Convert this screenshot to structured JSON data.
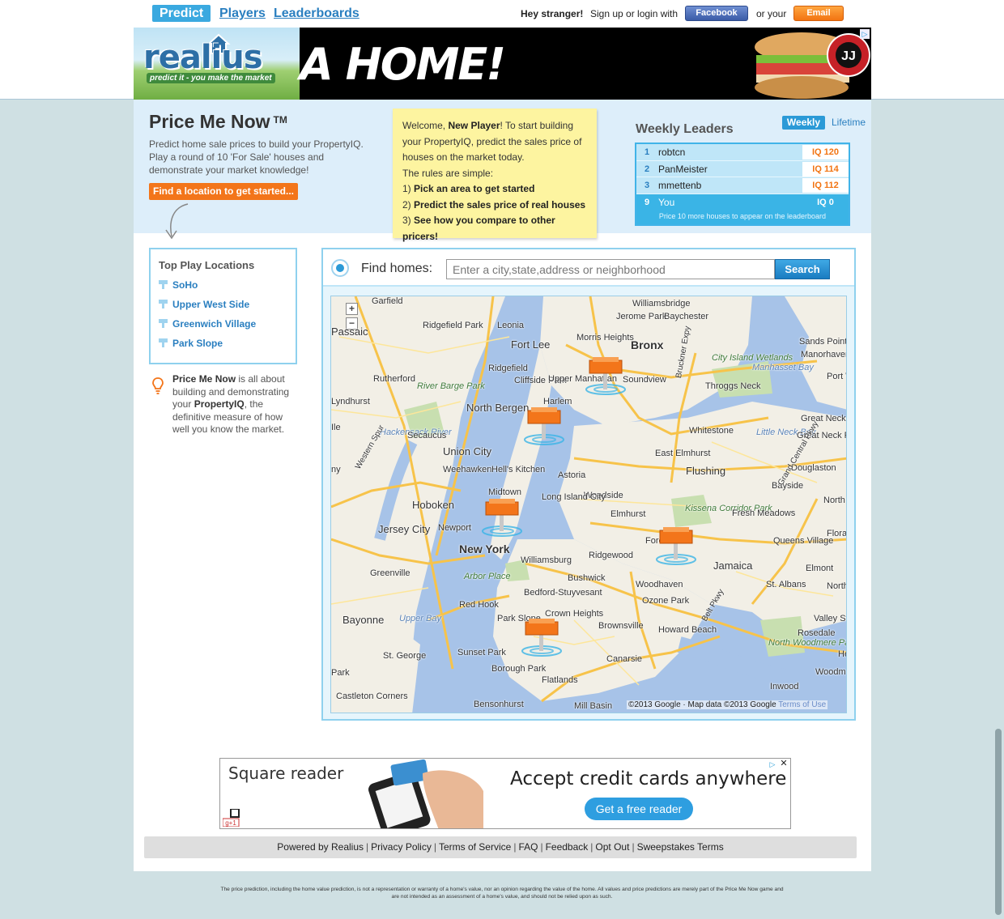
{
  "nav": {
    "tabs": [
      {
        "label": "Predict",
        "active": true
      },
      {
        "label": "Players",
        "active": false
      },
      {
        "label": "Leaderboards",
        "active": false
      }
    ],
    "greeting": "Hey stranger!",
    "signup_text": "Sign up or login with",
    "facebook_label": "Facebook",
    "or_your": "or your",
    "email_label": "Email"
  },
  "banner": {
    "logo_text": "realius",
    "logo_tagline": "predict it - you make the market",
    "ad_headline": "A HOME!",
    "ad_brand": "JIMMY JOHN'S"
  },
  "hero": {
    "title": "Price Me Now",
    "trademark": "TM",
    "description": "Predict home sale prices to build your PropertyIQ. Play a round of 10 'For Sale' houses and demonstrate your market knowledge!",
    "cta_label": "Find a location to get started..."
  },
  "welcome": {
    "intro_prefix": "Welcome, ",
    "intro_name": "New Player",
    "intro_rest": "! To start building your PropertyIQ, predict the sales price of houses on the market today.",
    "rules_intro": "The rules are simple:",
    "rules": [
      {
        "num": "1)",
        "text": "Pick an area to get started"
      },
      {
        "num": "2)",
        "text": "Predict the sales price of real houses"
      },
      {
        "num": "3)",
        "text": "See how you compare to other pricers!"
      }
    ]
  },
  "leaders": {
    "title": "Weekly Leaders",
    "weekly_label": "Weekly",
    "lifetime_label": "Lifetime",
    "rows": [
      {
        "rank": "1",
        "name": "robtcn",
        "iq": "IQ 120"
      },
      {
        "rank": "2",
        "name": "PanMeister",
        "iq": "IQ 114"
      },
      {
        "rank": "3",
        "name": "mmettenb",
        "iq": "IQ 112"
      },
      {
        "rank": "9",
        "name": "You",
        "iq": "IQ 0"
      }
    ],
    "footer": "Price 10 more houses to appear on the leaderboard"
  },
  "locations": {
    "title": "Top Play Locations",
    "items": [
      "SoHo",
      "Upper West Side",
      "Greenwich Village",
      "Park Slope"
    ]
  },
  "info": {
    "bold1": "Price Me Now",
    "text1": " is all about building and demonstrating your ",
    "bold2": "PropertyIQ",
    "text2": ", the definitive measure of how well you know the market."
  },
  "search": {
    "label": "Find homes:",
    "placeholder": "Enter a city,state,address or neighborhood",
    "button": "Search"
  },
  "map": {
    "zoom_in": "+",
    "zoom_out": "−",
    "copyright": "©2013 Google · Map data ©2013 Google",
    "terms": "Terms of Use",
    "labels": [
      {
        "text": "Garfield",
        "cls": ""
      },
      {
        "text": "Williamsbridge",
        "cls": ""
      },
      {
        "text": "Jerome Park",
        "cls": ""
      },
      {
        "text": "Baychester",
        "cls": ""
      },
      {
        "text": "Passaic",
        "cls": "mid"
      },
      {
        "text": "Ridgefield Park",
        "cls": ""
      },
      {
        "text": "Leonia",
        "cls": ""
      },
      {
        "text": "Fort Lee",
        "cls": "mid"
      },
      {
        "text": "Morris Heights",
        "cls": ""
      },
      {
        "text": "Bronx",
        "cls": "big"
      },
      {
        "text": "Sands Point",
        "cls": ""
      },
      {
        "text": "Manorhaven",
        "cls": ""
      },
      {
        "text": "City Island Wetlands",
        "cls": "park"
      },
      {
        "text": "Manhasset Bay",
        "cls": "water"
      },
      {
        "text": "Rutherford",
        "cls": ""
      },
      {
        "text": "Ridgefield",
        "cls": ""
      },
      {
        "text": "Cliffside Park",
        "cls": ""
      },
      {
        "text": "Upper Manhattan",
        "cls": ""
      },
      {
        "text": "Soundview",
        "cls": ""
      },
      {
        "text": "Throggs Neck",
        "cls": ""
      },
      {
        "text": "Port Washington",
        "cls": ""
      },
      {
        "text": "River Barge Park",
        "cls": "park"
      },
      {
        "text": "Harlem",
        "cls": ""
      },
      {
        "text": "Lyndhurst",
        "cls": ""
      },
      {
        "text": "North Bergen",
        "cls": "mid"
      },
      {
        "text": "Whitestone",
        "cls": ""
      },
      {
        "text": "Great Neck",
        "cls": ""
      },
      {
        "text": "Hackensack River",
        "cls": "water"
      },
      {
        "text": "Secaucus",
        "cls": ""
      },
      {
        "text": "Little Neck Bay",
        "cls": "water"
      },
      {
        "text": "Great Neck Plaza",
        "cls": ""
      },
      {
        "text": "Union City",
        "cls": "mid"
      },
      {
        "text": "East Elmhurst",
        "cls": ""
      },
      {
        "text": "Weehawken",
        "cls": ""
      },
      {
        "text": "Hell's Kitchen",
        "cls": ""
      },
      {
        "text": "Flushing",
        "cls": "mid"
      },
      {
        "text": "Douglaston",
        "cls": ""
      },
      {
        "text": "Astoria",
        "cls": ""
      },
      {
        "text": "Bayside",
        "cls": ""
      },
      {
        "text": "Midtown",
        "cls": ""
      },
      {
        "text": "Woodside",
        "cls": ""
      },
      {
        "text": "Hoboken",
        "cls": "mid"
      },
      {
        "text": "Long Island City",
        "cls": ""
      },
      {
        "text": "Kissena Corridor Park",
        "cls": "park"
      },
      {
        "text": "North Hyde",
        "cls": ""
      },
      {
        "text": "Elmhurst",
        "cls": ""
      },
      {
        "text": "Fresh Meadows",
        "cls": ""
      },
      {
        "text": "Jersey City",
        "cls": "mid"
      },
      {
        "text": "Newport",
        "cls": ""
      },
      {
        "text": "Floral Par",
        "cls": ""
      },
      {
        "text": "New York",
        "cls": "big"
      },
      {
        "text": "Forest Hills",
        "cls": ""
      },
      {
        "text": "Queens Village",
        "cls": ""
      },
      {
        "text": "Ridgewood",
        "cls": ""
      },
      {
        "text": "Williamsburg",
        "cls": ""
      },
      {
        "text": "Jamaica",
        "cls": "mid"
      },
      {
        "text": "Elmont",
        "cls": ""
      },
      {
        "text": "Greenville",
        "cls": ""
      },
      {
        "text": "Arbor Place",
        "cls": "park"
      },
      {
        "text": "Bushwick",
        "cls": ""
      },
      {
        "text": "St. Albans",
        "cls": ""
      },
      {
        "text": "Woodhaven",
        "cls": ""
      },
      {
        "text": "North Valley Stream",
        "cls": ""
      },
      {
        "text": "Bedford-Stuyvesant",
        "cls": ""
      },
      {
        "text": "Red Hook",
        "cls": ""
      },
      {
        "text": "Ozone Park",
        "cls": ""
      },
      {
        "text": "Upper Bay",
        "cls": "water"
      },
      {
        "text": "Bayonne",
        "cls": "mid"
      },
      {
        "text": "Crown Heights",
        "cls": ""
      },
      {
        "text": "Park Slope",
        "cls": ""
      },
      {
        "text": "Brownsville",
        "cls": ""
      },
      {
        "text": "Valley Stream",
        "cls": ""
      },
      {
        "text": "Rosedale",
        "cls": ""
      },
      {
        "text": "Howard Beach",
        "cls": ""
      },
      {
        "text": "Sunset Park",
        "cls": ""
      },
      {
        "text": "St. George",
        "cls": ""
      },
      {
        "text": "North Woodmere Park",
        "cls": "park"
      },
      {
        "text": "Hewl",
        "cls": ""
      },
      {
        "text": "Canarsie",
        "cls": ""
      },
      {
        "text": "Borough Park",
        "cls": ""
      },
      {
        "text": "Park",
        "cls": ""
      },
      {
        "text": "Woodmere",
        "cls": ""
      },
      {
        "text": "Flatlands",
        "cls": ""
      },
      {
        "text": "Inwood",
        "cls": ""
      },
      {
        "text": "Castleton Corners",
        "cls": ""
      },
      {
        "text": "Bensonhurst",
        "cls": ""
      },
      {
        "text": "Mill Basin",
        "cls": ""
      },
      {
        "text": "Ile",
        "cls": ""
      },
      {
        "text": "ny",
        "cls": ""
      },
      {
        "text": "Belt Pkwy",
        "cls": ""
      },
      {
        "text": "Bruckner Expy",
        "cls": ""
      },
      {
        "text": "Grand Central Pkwy",
        "cls": ""
      },
      {
        "text": "Western Spur",
        "cls": ""
      }
    ]
  },
  "bottom_ad": {
    "brand": "Square reader",
    "tagline": "Accept credit cards anywhere",
    "button": "Get a free reader",
    "close": "✕",
    "choices": "▷"
  },
  "footer": {
    "links": [
      "Powered by Realius",
      "Privacy Policy",
      "Terms of Service",
      "FAQ",
      "Feedback",
      "Opt Out",
      "Sweepstakes Terms"
    ],
    "disclaimer": "The price prediction, including the home value prediction, is not a representation or warranty of a home's value, nor an opinion regarding the value of the home. All values and price predictions are merely part of the Price Me Now game and are not intended as an assessment of a home's value, and should not be relied upon as such."
  },
  "colors": {
    "accent_blue": "#2a7fc0",
    "active_tab": "#3aa9e0",
    "orange": "#f3751a",
    "page_bg": "#cfe0e3",
    "hero_bg": "#ddeefa",
    "sticky_note": "#fdf4a0"
  }
}
